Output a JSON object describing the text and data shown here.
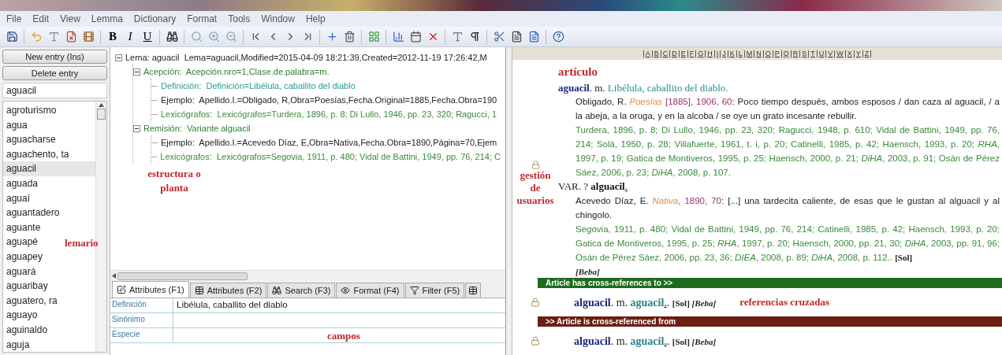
{
  "menu": [
    "File",
    "Edit",
    "View",
    "Lemma",
    "Dictionary",
    "Format",
    "Tools",
    "Window",
    "Help"
  ],
  "format_buttons": [
    {
      "label": "B",
      "kind": "bold"
    },
    {
      "label": "I",
      "kind": "italic"
    },
    {
      "label": "U",
      "kind": "underline"
    }
  ],
  "sidebar": {
    "buttons": [
      "New entry (Ins)",
      "Delete entry"
    ],
    "search_value": "aguacil",
    "items": [
      {
        "label": "agroturismo",
        "selected": false
      },
      {
        "label": "agua",
        "selected": false
      },
      {
        "label": "aguacharse",
        "selected": false
      },
      {
        "label": "aguachento, ta",
        "selected": false
      },
      {
        "label": "aguacil",
        "selected": true
      },
      {
        "label": "aguada",
        "selected": false
      },
      {
        "label": "aguaí",
        "selected": false
      },
      {
        "label": "aguantadero",
        "selected": false
      },
      {
        "label": "aguante",
        "selected": false
      },
      {
        "label": "aguapé",
        "selected": false
      },
      {
        "label": "aguapey",
        "selected": false
      },
      {
        "label": "aguará",
        "selected": false
      },
      {
        "label": "aguaribay",
        "selected": false
      },
      {
        "label": "aguatero, ra",
        "selected": false
      },
      {
        "label": "aguayo",
        "selected": false
      },
      {
        "label": "aguinaldo",
        "selected": false
      },
      {
        "label": "aguja",
        "selected": false
      }
    ]
  },
  "tree": [
    {
      "label": "Lema: aguacil",
      "detail": "Lema=aguacil,Modified=2015-04-09 18:21:39,Created=2012-11-19 17:26:42,M",
      "color": "#222222",
      "expanded": true,
      "children": [
        {
          "label": "Acepción:",
          "detail": "Acepción.nro=1,Clase.de.palabra=m.",
          "color": "#2e7d32",
          "expanded": true,
          "children": [
            {
              "label": "Definición:",
              "detail": "Definición=Libélula, caballito del diablo",
              "color": "#2a9d8f"
            },
            {
              "label": "Ejemplo:",
              "detail": "Apellido.I.=Obligado, R,Obra=Poesías,Fecha.Original=1885,Fecha.Obra=190",
              "color": "#222222"
            },
            {
              "label": "Lexicógrafos:",
              "detail": "Lexicógrafos=Turdera, 1896, p. 8; Di Lullo, 1946, pp. 23, 320; Ragucci, 1",
              "color": "#3a8a3a"
            }
          ]
        },
        {
          "label": "Remisión:",
          "detail": "Variante alguacil",
          "color": "#2e7d32",
          "expanded": true,
          "children": [
            {
              "label": "Ejemplo:",
              "detail": "Apellido.I.=Acevedo Díaz, E,Obra=Nativa,Fecha.Obra=1890,Página=70,Ejem",
              "color": "#222222"
            },
            {
              "label": "Lexicógrafos:",
              "detail": "Lexicógrafos=Segovia, 1911, p. 480; Vidal de Battini, 1949, pp. 76, 214; C",
              "color": "#3a8a3a"
            }
          ]
        }
      ]
    }
  ],
  "tabs": [
    {
      "label": "Attributes (F1)",
      "selected": true
    },
    {
      "label": "Attributes (F2)",
      "selected": false
    },
    {
      "label": "Search (F3)",
      "selected": false
    },
    {
      "label": "Format (F4)",
      "selected": false
    },
    {
      "label": "Filter (F5)",
      "selected": false
    }
  ],
  "fields": [
    {
      "label": "Definición",
      "value": "Libélula, caballito del diablo"
    },
    {
      "label": "Sinónimo"
    },
    {
      "label": "Especie"
    }
  ],
  "alphabet": [
    "A",
    "B",
    "C",
    "D",
    "E",
    "F",
    "G",
    "H",
    "I",
    "J",
    "K",
    "L",
    "M",
    "N",
    "O",
    "P",
    "Q",
    "R",
    "S",
    "T",
    "U",
    "V",
    "W",
    "X",
    "Y",
    "Z"
  ],
  "article": [
    {
      "kind": "head",
      "runs": [
        {
          "kind": "head",
          "text": "aguacil"
        },
        {
          "kind": "gram",
          "text": ". m. "
        },
        {
          "kind": "def",
          "text": "Libélula, caballito del diablo."
        }
      ]
    },
    {
      "kind": "quote",
      "runs": [
        {
          "kind": "plain",
          "text": "Obligado, R. "
        },
        {
          "kind": "title",
          "text": "Poesías"
        },
        {
          "kind": "date",
          "text": " [1885], 1906, 60"
        },
        {
          "kind": "plain",
          "text": ": Poco tiempo después, ambos esposos / dan caza al aguacil, / a la abeja, a la oruga, y en la alcoba / se oye un grato incesante rebullir."
        }
      ]
    },
    {
      "kind": "quote",
      "runs": [
        {
          "kind": "lex",
          "text": "Turdera, 1896, p. 8; Di Lullo, 1946, pp. 23, 320; Ragucci, 1948, p. 610; Vidal de Battini, 1949, pp. 76, 214; Solá, 1950, p. 28; Villafuerte, 1961, t. i, p. 20; Catinelli, 1985, p. 42; Haensch, 1993, p. 20; "
        },
        {
          "kind": "lex_italic",
          "text": "RHA"
        },
        {
          "kind": "lex",
          "text": ", 1997, p. 19; Gatica de Montiveros, 1995, p. 25; Haensch, 2000, p. 21; "
        },
        {
          "kind": "lex_italic",
          "text": "DiHA"
        },
        {
          "kind": "lex",
          "text": ", 2003, p. 91; Osán de Pérez Sáez, 2006, p. 23; "
        },
        {
          "kind": "lex_italic",
          "text": "DiHA"
        },
        {
          "kind": "lex",
          "text": ", 2008, p. 107."
        }
      ]
    },
    {
      "kind": "head",
      "runs": [
        {
          "kind": "gram",
          "text": "VAR. ? "
        },
        {
          "kind": "bold",
          "text": "alguacil"
        },
        {
          "kind": "under",
          "text": "."
        }
      ]
    },
    {
      "kind": "quote",
      "runs": [
        {
          "kind": "plain",
          "text": "Acevedo Díaz, E. "
        },
        {
          "kind": "title",
          "text": "Nativa"
        },
        {
          "kind": "date",
          "text": ", 1890, 70"
        },
        {
          "kind": "plain",
          "text": ": [...] una tardecita caliente, de esas que le gustan al alguacil y al chingolo."
        }
      ]
    },
    {
      "kind": "quote",
      "runs": [
        {
          "kind": "lex",
          "text": "Segovia, 1911, p. 480; Vidal de Battini, 1949, pp. 76, 214; Catinelli, 1985, p. 42; Haensch, 1993, p. 20; Gatica de Montiveros, 1995, p. 25; "
        },
        {
          "kind": "lex_italic",
          "text": "RHA"
        },
        {
          "kind": "lex",
          "text": ", 1997, p. 20; Haensch, 2000, pp. 21, 30; "
        },
        {
          "kind": "lex_italic",
          "text": "DiHA"
        },
        {
          "kind": "lex",
          "text": ", 2003, pp. 91, 96; Osán de Pérez Sáez, 2006, pp. 23, 36; "
        },
        {
          "kind": "lex_italic",
          "text": "DIEA"
        },
        {
          "kind": "lex",
          "text": ", 2008, p. 89; "
        },
        {
          "kind": "lex_italic",
          "text": "DiHA"
        },
        {
          "kind": "lex",
          "text": ", 2008, p. 112.. "
        },
        {
          "kind": "tag",
          "text": "[Sol]"
        }
      ]
    },
    {
      "kind": "quote",
      "runs": [
        {
          "kind": "user",
          "text": "[Beba]"
        }
      ]
    }
  ],
  "cross_sections": [
    {
      "title": "Article has cross-references to >>",
      "color": "#1e6b1e",
      "locked": true,
      "runs": [
        {
          "kind": "head",
          "text": "alguacil"
        },
        {
          "kind": "gram",
          "text": ". m. "
        },
        {
          "kind": "ref",
          "text": "aguacil"
        },
        {
          "kind": "under",
          "text": "."
        },
        {
          "kind": "gram",
          "text": ". "
        },
        {
          "kind": "tag",
          "text": "[Sol] "
        },
        {
          "kind": "user",
          "text": "[Beba]"
        }
      ]
    },
    {
      "title": ">> Article is cross-referenced from",
      "color": "#6b1e12",
      "locked": true,
      "runs": [
        {
          "kind": "head",
          "text": "alguacil"
        },
        {
          "kind": "gram",
          "text": ". m. "
        },
        {
          "kind": "ref",
          "text": "aguacil"
        },
        {
          "kind": "under",
          "text": "."
        },
        {
          "kind": "gram",
          "text": ". "
        },
        {
          "kind": "tag",
          "text": "[Sol] "
        },
        {
          "kind": "user",
          "text": "[Beba]"
        }
      ]
    }
  ],
  "annotations": {
    "articulo": "artículo",
    "estructura": "estructura o planta",
    "lemario": "lemario",
    "usuarios": "gestión de usuarios",
    "referencias": "referencias cruzadas",
    "campos": "campos"
  }
}
